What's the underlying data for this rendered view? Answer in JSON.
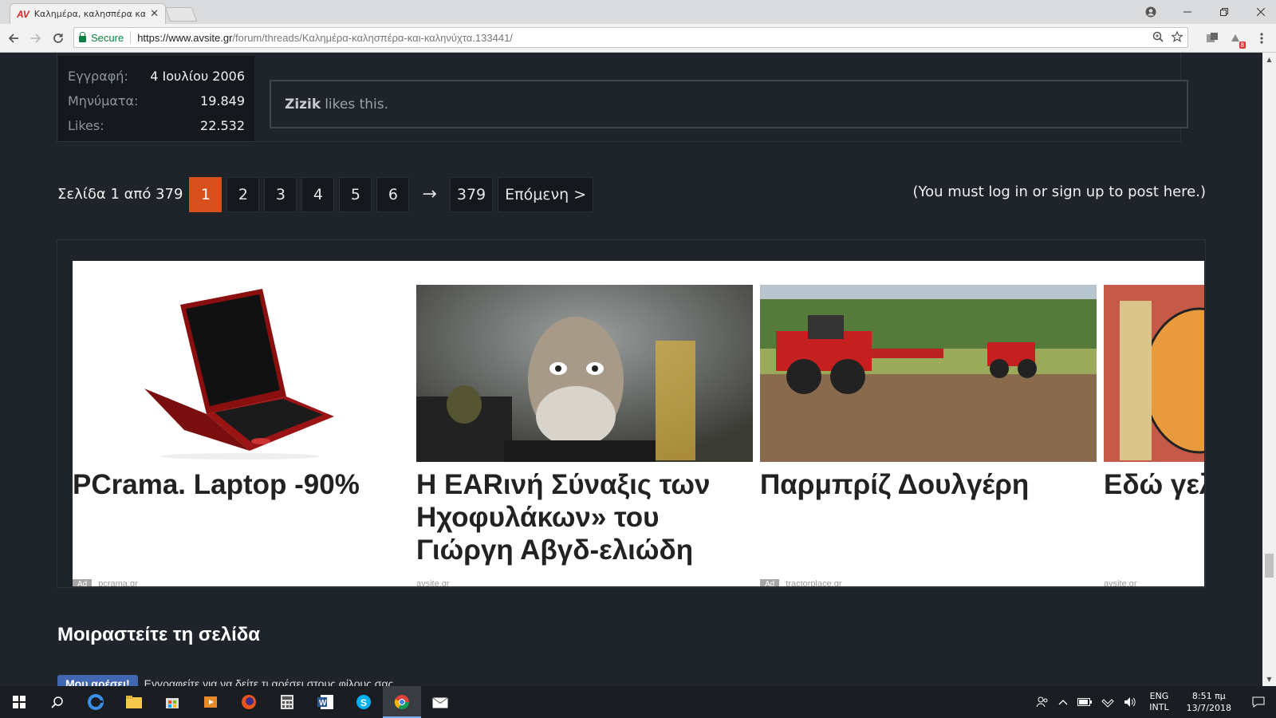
{
  "browser": {
    "tab_title": "Καλημέρα, καλησπέρα και",
    "favicon_text": "AV",
    "close_glyph": "✕",
    "secure_label": "Secure",
    "url_scheme_host": "https://www.avsite.gr",
    "url_path": "/forum/threads/Καλημέρα-καλησπέρα-και-καληνύχτα.133441/",
    "extension_badge": "8"
  },
  "user_info": {
    "rows": [
      {
        "label": "Εγγραφή:",
        "value": "4 Ιουλίου 2006"
      },
      {
        "label": "Μηνύματα:",
        "value": "19.849"
      },
      {
        "label": "Likes:",
        "value": "22.532"
      }
    ]
  },
  "likes": {
    "user": "Zizik",
    "text": "likes this."
  },
  "pagination": {
    "info": "Σελίδα 1 από 379",
    "pages": [
      "1",
      "2",
      "3",
      "4",
      "5",
      "6"
    ],
    "active": "1",
    "arrow": "→",
    "last": "379",
    "next": "Επόμενη >"
  },
  "login_note": "(You must log in or sign up to post here.)",
  "ads": [
    {
      "title": "PCrama. Laptop -90%",
      "badge": "Ad",
      "source": "pcrama.gr"
    },
    {
      "title": "Η EARινή Σύναξις των Ηχοφυλάκων» του Γιώργη Αβγδ-ελιώδη",
      "badge": "",
      "source": "avsite.gr"
    },
    {
      "title": "Παρμπρίζ Δουλγέρη",
      "badge": "Ad",
      "source": "tractorplace.gr"
    },
    {
      "title": "Εδώ γελ",
      "badge": "",
      "source": "avsite.gr"
    }
  ],
  "share": {
    "title": "Μοιραστείτε τη σελίδα",
    "fb_label": "Μου αρέσει!",
    "text": "Εγγραφείτε για να δείτε τι αρέσει στους φίλους σας."
  },
  "taskbar": {
    "lang_top": "ENG",
    "lang_bottom": "INTL",
    "time": "8:51 πμ",
    "date": "13/7/2018"
  }
}
